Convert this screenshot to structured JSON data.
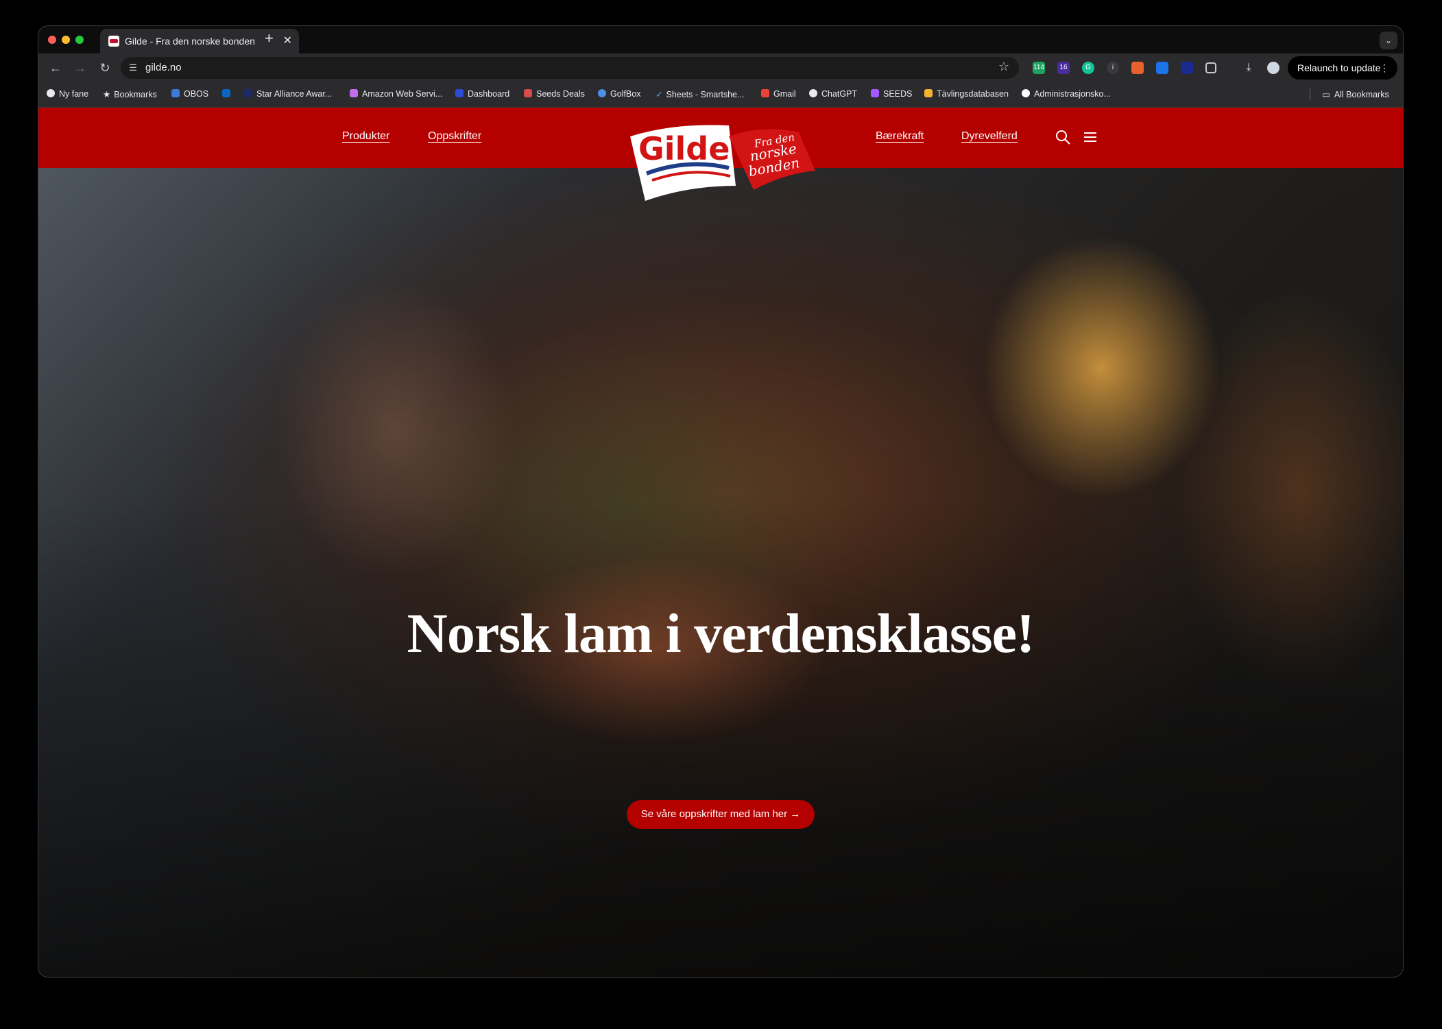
{
  "browser": {
    "tab": {
      "title": "Gilde - Fra den norske bonden",
      "close_glyph": "✕"
    },
    "new_tab_glyph": "+",
    "tab_menu_glyph": "⌄",
    "nav": {
      "back": "←",
      "forward": "→",
      "reload": "↻"
    },
    "url": "gilde.no",
    "bookmark_star": "☆",
    "extension_badges": {
      "calendar": "114",
      "notif": "16"
    },
    "relaunch_label": "Relaunch to update",
    "relaunch_menu_glyph": "⋮"
  },
  "bookmarks": {
    "items": [
      {
        "label": "Ny fane",
        "icon": "chrome-icon"
      },
      {
        "label": "Bookmarks",
        "icon": "star-icon"
      },
      {
        "label": "OBOS",
        "icon": "obos-icon"
      },
      {
        "label": "",
        "icon": "linkedin-icon"
      },
      {
        "label": "Star Alliance Awar...",
        "icon": "star-alliance-icon"
      },
      {
        "label": "Amazon Web Servi...",
        "icon": "aws-icon"
      },
      {
        "label": "Dashboard",
        "icon": "dashboard-icon"
      },
      {
        "label": "Seeds Deals",
        "icon": "seeds-icon"
      },
      {
        "label": "GolfBox",
        "icon": "globe-icon"
      },
      {
        "label": "Sheets - Smartshe...",
        "icon": "smartsheet-icon"
      },
      {
        "label": "Gmail",
        "icon": "gmail-icon"
      },
      {
        "label": "ChatGPT",
        "icon": "chatgpt-icon"
      },
      {
        "label": "SEEDS",
        "icon": "figma-icon"
      },
      {
        "label": "Tävlingsdatabasen",
        "icon": "trophy-icon"
      },
      {
        "label": "Administrasjonsko...",
        "icon": "google-icon"
      }
    ],
    "all_bookmarks": "All Bookmarks"
  },
  "site": {
    "nav_left": [
      "Produkter",
      "Oppskrifter"
    ],
    "nav_right": [
      "Bærekraft",
      "Dyrevelferd"
    ],
    "logo": {
      "brand": "Gilde",
      "tagline_1": "Fra den",
      "tagline_2": "norske",
      "tagline_3": "bonden"
    },
    "hero": {
      "headline": "Norsk lam i verdensklasse!",
      "cta": "Se våre oppskrifter med lam her →"
    }
  },
  "colors": {
    "brand_red": "#b50000",
    "chrome_dark": "#2b2b2e",
    "text_light": "#e8eaed"
  }
}
